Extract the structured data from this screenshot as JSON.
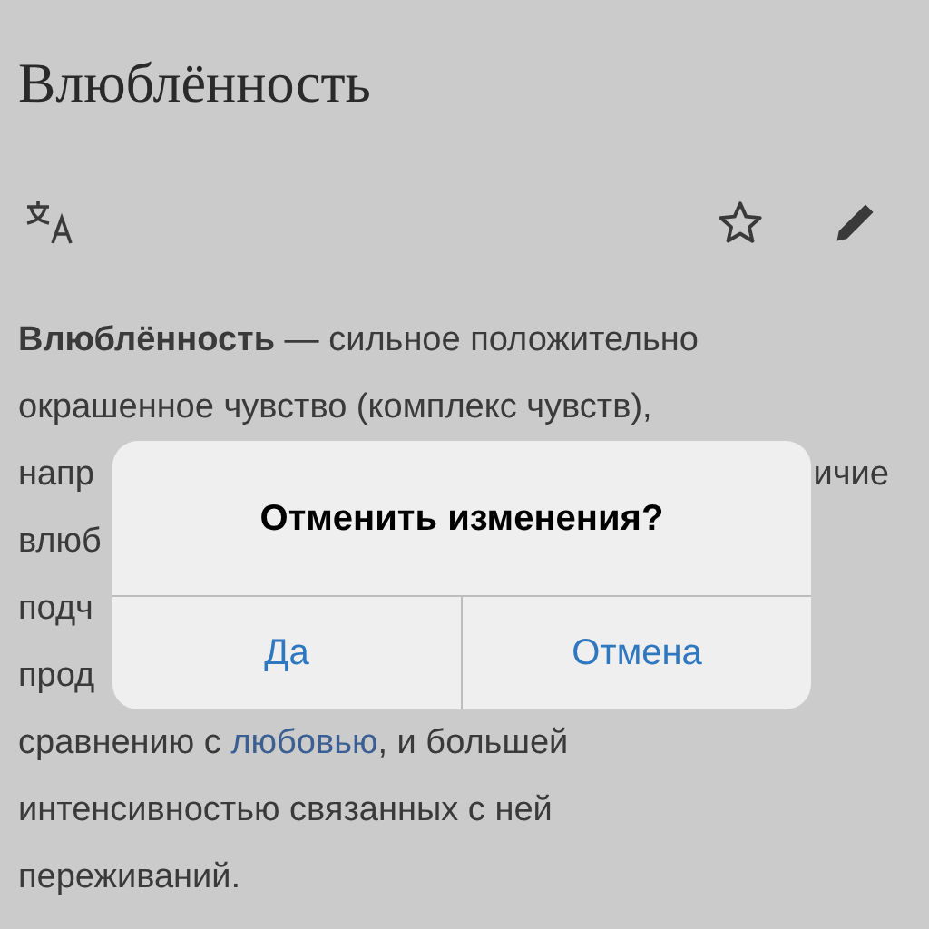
{
  "article": {
    "title": "Влюблённость",
    "lines": [
      {
        "kind": "text",
        "text": "**Влюблённость** — сильное положительно"
      },
      {
        "kind": "text",
        "text": "окрашенное чувство (комплекс чувств),"
      },
      {
        "kind": "split",
        "left": "напр",
        "right": "ичие"
      },
      {
        "kind": "split",
        "left": "влюб"
      },
      {
        "kind": "split",
        "left": "подч"
      },
      {
        "kind": "split",
        "left": "прод"
      },
      {
        "kind": "link",
        "before": "сравнению с ",
        "link": "любовью",
        "after": ", и большей"
      },
      {
        "kind": "text",
        "text": "интенсивностью связанных с ней"
      },
      {
        "kind": "text",
        "text": "переживаний."
      }
    ]
  },
  "dialog": {
    "title": "Отменить изменения?",
    "buttons": [
      "Да",
      "Отмена"
    ]
  }
}
